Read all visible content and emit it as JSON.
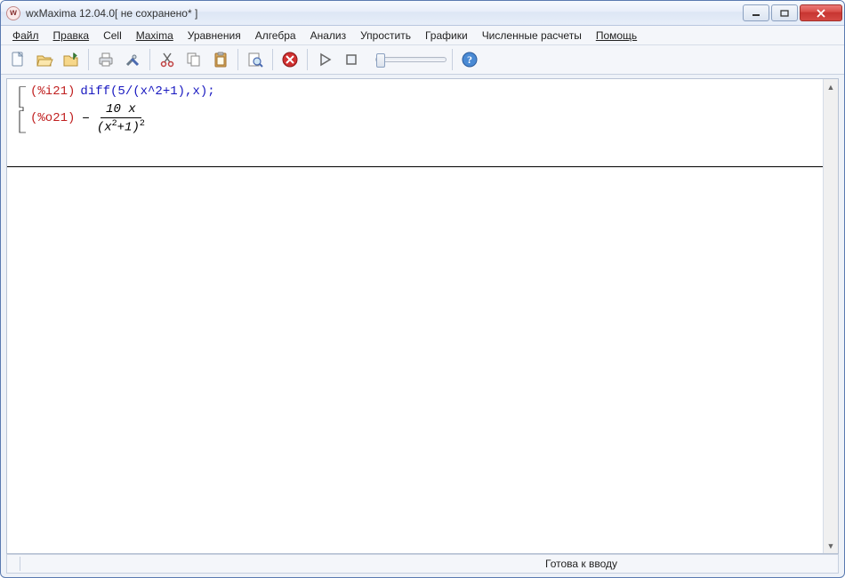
{
  "title": "wxMaxima 12.04.0[ не сохранено* ]",
  "menu": {
    "file": "Файл",
    "edit": "Правка",
    "cell": "Cell",
    "maxima": "Maxima",
    "equations": "Уравнения",
    "algebra": "Алгебра",
    "analysis": "Анализ",
    "simplify": "Упростить",
    "graphics": "Графики",
    "numeric": "Численные расчеты",
    "help": "Помощь"
  },
  "toolbar": {
    "icons": {
      "new": "new-file-icon",
      "open": "open-icon",
      "save": "save-icon",
      "print": "print-icon",
      "prefs": "prefs-icon",
      "cut": "cut-icon",
      "copy": "copy-icon",
      "paste": "paste-icon",
      "find": "find-icon",
      "stop": "stop-icon",
      "run": "run-icon",
      "abort": "abort-icon",
      "help": "help-icon"
    }
  },
  "cell": {
    "input_label": "(%i21)",
    "input_code": "diff(5/(x^2+1),x);",
    "output_label": "(%o21)",
    "output": {
      "sign": "−",
      "numerator": "10 x",
      "denom_base": "x",
      "denom_exp_inner": "2",
      "denom_plus": "+1",
      "denom_exp_outer": "2"
    }
  },
  "status": "Готова к вводу"
}
